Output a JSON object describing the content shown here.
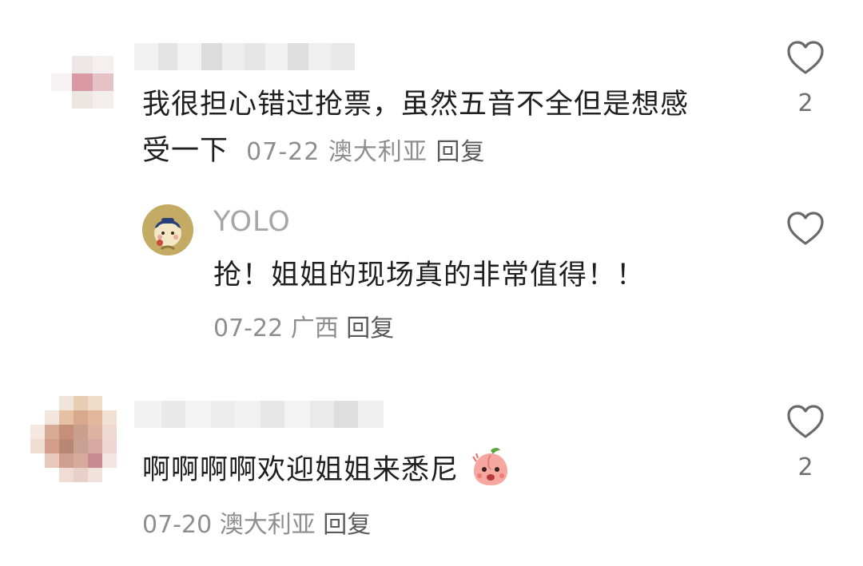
{
  "comments": [
    {
      "text": "我很担心错过抢票，虽然五音不全但是想感受一下",
      "text_line1": "我很担心错过抢票，虽然五音不全但是想感",
      "text_line2": "受一下",
      "date": "07-22",
      "location": "澳大利亚",
      "reply_label": "回复",
      "like_count": "2",
      "replies": [
        {
          "username": "YOLO",
          "text": "抢！姐姐的现场真的非常值得！！",
          "date": "07-22",
          "location": "广西",
          "reply_label": "回复",
          "like_count": ""
        }
      ]
    },
    {
      "text": "啊啊啊啊欢迎姐姐来悉尼",
      "emoji": "peach-emoji",
      "date": "07-20",
      "location": "澳大利亚",
      "reply_label": "回复",
      "like_count": "2"
    }
  ],
  "icons": {
    "like": "heart-outline-icon"
  },
  "colors": {
    "text": "#1f1f1f",
    "meta": "#8e8e8e",
    "username": "#a6a6a6"
  }
}
